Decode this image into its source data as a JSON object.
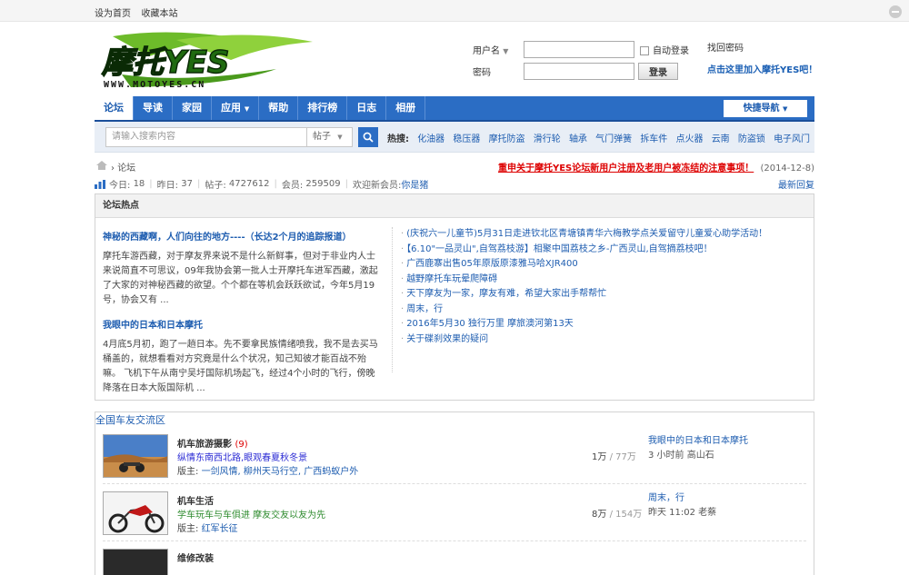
{
  "topbar": {
    "set_home": "设为首页",
    "bookmark": "收藏本站"
  },
  "login": {
    "username_label": "用户名",
    "password_label": "密码",
    "auto_login": "自动登录",
    "login_button": "登录",
    "forgot_password": "找回密码",
    "register": "点击这里加入摩托YES吧！"
  },
  "nav": {
    "items": [
      "论坛",
      "导读",
      "家园",
      "应用",
      "帮助",
      "排行榜",
      "日志",
      "相册"
    ],
    "quick_nav": "快捷导航"
  },
  "search": {
    "placeholder": "请输入搜索内容",
    "type": "帖子",
    "hot_label": "热搜:",
    "hot_terms": [
      "化油器",
      "稳压器",
      "摩托防盗",
      "滑行轮",
      "轴承",
      "气门弹簧",
      "拆车件",
      "点火器",
      "云南",
      "防盗锁",
      "电子风门"
    ]
  },
  "breadcrumb": {
    "current": "论坛",
    "notice": "重申关于摩托YES论坛新用户注册及老用户被冻结的注意事项！",
    "notice_date": "(2014-12-8)"
  },
  "stats": {
    "today_label": "今日:",
    "today": "18",
    "yesterday_label": "昨日:",
    "yesterday": "37",
    "posts_label": "帖子:",
    "posts": "4727612",
    "members_label": "会员:",
    "members": "259509",
    "newuser_label": "欢迎新会员:",
    "newuser": "你是猪",
    "latest": "最新回复"
  },
  "hot": {
    "title": "论坛热点",
    "articles": [
      {
        "title": "神秘的西藏啊，人们向往的地方----（长达2个月的追踪报道）",
        "text": "摩托车游西藏，对于摩友界来说不是什么新鲜事，但对于非业内人士来说简直不可思议，09年我协会第一批人士开摩托车进军西藏，激起了大家的对神秘西藏的欲望。个个都在等机会跃跃欲试，今年5月19号，协会又有 ..."
      },
      {
        "title": "我眼中的日本和日本摩托",
        "text": "4月底5月初，跑了一趟日本。先不要拿民族情绪喷我，我不是去买马桶盖的，就想看看对方究竟是什么个状况，知己知彼才能百战不殆嘛。  飞机下午从南宁吴圩国际机场起飞，经过4个小时的飞行，傍晚降落在日本大阪国际机 ..."
      }
    ],
    "list": [
      "(庆祝六一儿童节)5月31日走进钦北区青塘镇青华六梅教学点关爱留守儿童爱心助学活动！",
      "【6.10\"一品灵山\",自驾荔枝游】相聚中国荔枝之乡-广西灵山,自驾摘荔枝吧！",
      "广西鹿寨出售05年原版原漆雅马哈XJR400",
      "越野摩托车玩晕爬障碍",
      "天下摩友为一家，摩友有难，希望大家出手帮帮忙",
      "周末，行",
      "2016年5月30 独行万里 摩旅澳河第13天",
      "关于碟刹效果的疑问"
    ]
  },
  "forums": {
    "title": "全国车友交流区",
    "items": [
      {
        "name": "机车旅游摄影",
        "count": "(9)",
        "desc": "纵情东南西北路,眼观春夏秋冬景",
        "desc_color": "#2a2ad4",
        "moderator_label": "版主:",
        "moderators": "一剑风情, 柳州天马行空, 广西蚂蚁户外",
        "topics": "1万",
        "posts": "77万",
        "last_title": "我眼中的日本和日本摩托",
        "last_meta": "3 小时前 高山石"
      },
      {
        "name": "机车生活",
        "count": "",
        "desc": "学车玩车与车俱进    摩友交友以友为先",
        "desc_color": "#2e8b2e",
        "moderator_label": "版主:",
        "moderators": "红军长征",
        "topics": "8万",
        "posts": "154万",
        "last_title": "周末，行",
        "last_meta": "昨天 11:02 老蔡"
      },
      {
        "name": "维修改装",
        "count": "",
        "desc": "",
        "desc_color": "#333333",
        "moderator_label": "",
        "moderators": "",
        "topics": "",
        "posts": "",
        "last_title": "",
        "last_meta": ""
      }
    ]
  },
  "colors": {
    "nav_blue": "#2b6dc4",
    "link": "#1e5db0",
    "alert": "#dd0000"
  }
}
